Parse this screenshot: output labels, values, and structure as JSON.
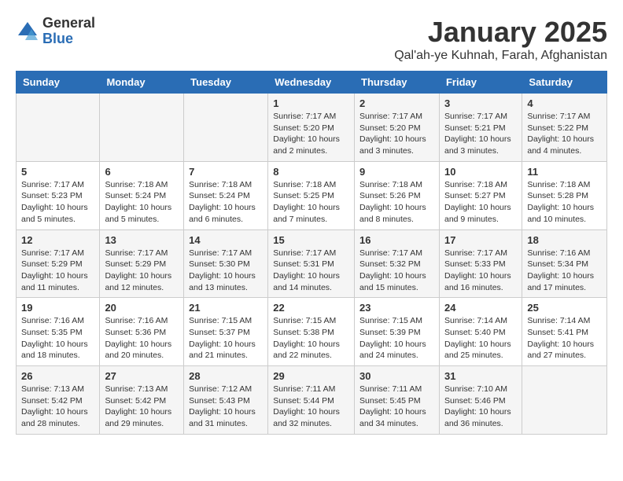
{
  "logo": {
    "general": "General",
    "blue": "Blue"
  },
  "title": "January 2025",
  "subtitle": "Qal'ah-ye Kuhnah, Farah, Afghanistan",
  "headers": [
    "Sunday",
    "Monday",
    "Tuesday",
    "Wednesday",
    "Thursday",
    "Friday",
    "Saturday"
  ],
  "weeks": [
    [
      {
        "day": "",
        "detail": ""
      },
      {
        "day": "",
        "detail": ""
      },
      {
        "day": "",
        "detail": ""
      },
      {
        "day": "1",
        "detail": "Sunrise: 7:17 AM\nSunset: 5:20 PM\nDaylight: 10 hours\nand 2 minutes."
      },
      {
        "day": "2",
        "detail": "Sunrise: 7:17 AM\nSunset: 5:20 PM\nDaylight: 10 hours\nand 3 minutes."
      },
      {
        "day": "3",
        "detail": "Sunrise: 7:17 AM\nSunset: 5:21 PM\nDaylight: 10 hours\nand 3 minutes."
      },
      {
        "day": "4",
        "detail": "Sunrise: 7:17 AM\nSunset: 5:22 PM\nDaylight: 10 hours\nand 4 minutes."
      }
    ],
    [
      {
        "day": "5",
        "detail": "Sunrise: 7:17 AM\nSunset: 5:23 PM\nDaylight: 10 hours\nand 5 minutes."
      },
      {
        "day": "6",
        "detail": "Sunrise: 7:18 AM\nSunset: 5:24 PM\nDaylight: 10 hours\nand 5 minutes."
      },
      {
        "day": "7",
        "detail": "Sunrise: 7:18 AM\nSunset: 5:24 PM\nDaylight: 10 hours\nand 6 minutes."
      },
      {
        "day": "8",
        "detail": "Sunrise: 7:18 AM\nSunset: 5:25 PM\nDaylight: 10 hours\nand 7 minutes."
      },
      {
        "day": "9",
        "detail": "Sunrise: 7:18 AM\nSunset: 5:26 PM\nDaylight: 10 hours\nand 8 minutes."
      },
      {
        "day": "10",
        "detail": "Sunrise: 7:18 AM\nSunset: 5:27 PM\nDaylight: 10 hours\nand 9 minutes."
      },
      {
        "day": "11",
        "detail": "Sunrise: 7:18 AM\nSunset: 5:28 PM\nDaylight: 10 hours\nand 10 minutes."
      }
    ],
    [
      {
        "day": "12",
        "detail": "Sunrise: 7:17 AM\nSunset: 5:29 PM\nDaylight: 10 hours\nand 11 minutes."
      },
      {
        "day": "13",
        "detail": "Sunrise: 7:17 AM\nSunset: 5:29 PM\nDaylight: 10 hours\nand 12 minutes."
      },
      {
        "day": "14",
        "detail": "Sunrise: 7:17 AM\nSunset: 5:30 PM\nDaylight: 10 hours\nand 13 minutes."
      },
      {
        "day": "15",
        "detail": "Sunrise: 7:17 AM\nSunset: 5:31 PM\nDaylight: 10 hours\nand 14 minutes."
      },
      {
        "day": "16",
        "detail": "Sunrise: 7:17 AM\nSunset: 5:32 PM\nDaylight: 10 hours\nand 15 minutes."
      },
      {
        "day": "17",
        "detail": "Sunrise: 7:17 AM\nSunset: 5:33 PM\nDaylight: 10 hours\nand 16 minutes."
      },
      {
        "day": "18",
        "detail": "Sunrise: 7:16 AM\nSunset: 5:34 PM\nDaylight: 10 hours\nand 17 minutes."
      }
    ],
    [
      {
        "day": "19",
        "detail": "Sunrise: 7:16 AM\nSunset: 5:35 PM\nDaylight: 10 hours\nand 18 minutes."
      },
      {
        "day": "20",
        "detail": "Sunrise: 7:16 AM\nSunset: 5:36 PM\nDaylight: 10 hours\nand 20 minutes."
      },
      {
        "day": "21",
        "detail": "Sunrise: 7:15 AM\nSunset: 5:37 PM\nDaylight: 10 hours\nand 21 minutes."
      },
      {
        "day": "22",
        "detail": "Sunrise: 7:15 AM\nSunset: 5:38 PM\nDaylight: 10 hours\nand 22 minutes."
      },
      {
        "day": "23",
        "detail": "Sunrise: 7:15 AM\nSunset: 5:39 PM\nDaylight: 10 hours\nand 24 minutes."
      },
      {
        "day": "24",
        "detail": "Sunrise: 7:14 AM\nSunset: 5:40 PM\nDaylight: 10 hours\nand 25 minutes."
      },
      {
        "day": "25",
        "detail": "Sunrise: 7:14 AM\nSunset: 5:41 PM\nDaylight: 10 hours\nand 27 minutes."
      }
    ],
    [
      {
        "day": "26",
        "detail": "Sunrise: 7:13 AM\nSunset: 5:42 PM\nDaylight: 10 hours\nand 28 minutes."
      },
      {
        "day": "27",
        "detail": "Sunrise: 7:13 AM\nSunset: 5:42 PM\nDaylight: 10 hours\nand 29 minutes."
      },
      {
        "day": "28",
        "detail": "Sunrise: 7:12 AM\nSunset: 5:43 PM\nDaylight: 10 hours\nand 31 minutes."
      },
      {
        "day": "29",
        "detail": "Sunrise: 7:11 AM\nSunset: 5:44 PM\nDaylight: 10 hours\nand 32 minutes."
      },
      {
        "day": "30",
        "detail": "Sunrise: 7:11 AM\nSunset: 5:45 PM\nDaylight: 10 hours\nand 34 minutes."
      },
      {
        "day": "31",
        "detail": "Sunrise: 7:10 AM\nSunset: 5:46 PM\nDaylight: 10 hours\nand 36 minutes."
      },
      {
        "day": "",
        "detail": ""
      }
    ]
  ]
}
